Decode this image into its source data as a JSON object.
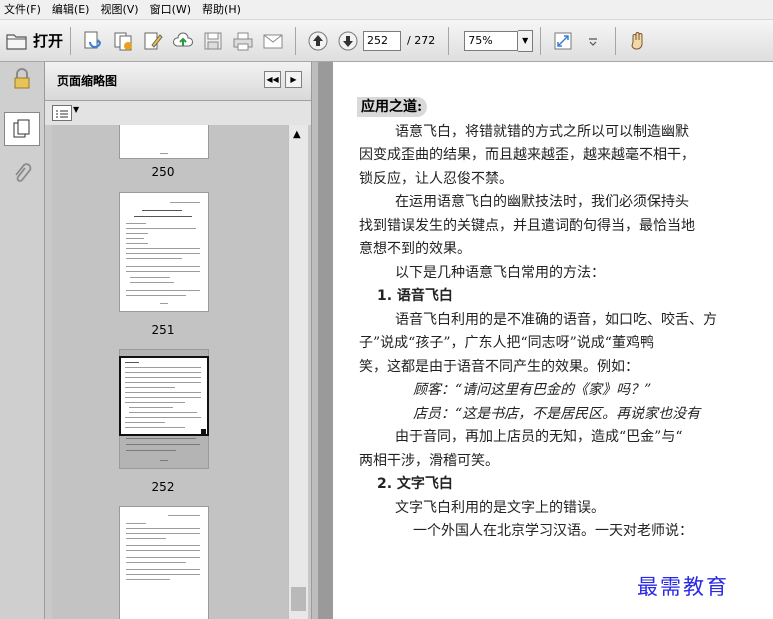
{
  "menu": [
    {
      "label": "文件(F)"
    },
    {
      "label": "编辑(E)"
    },
    {
      "label": "视图(V)"
    },
    {
      "label": "窗口(W)"
    },
    {
      "label": "帮助(H)"
    }
  ],
  "toolbar": {
    "open_label": "打开",
    "current_page": "252",
    "total_pages": "/ 272",
    "zoom": "75%"
  },
  "thumbnails_panel": {
    "title": "页面缩略图",
    "pages": [
      {
        "label": "250"
      },
      {
        "label": "251"
      },
      {
        "label": "252",
        "selected": true
      }
    ]
  },
  "document": {
    "heading": "应用之道:",
    "lines": [
      "语意飞白，将错就错的方式之所以可以制造幽默",
      "因变成歪曲的结果，而且越来越歪，越来越毫不相干，",
      "锁反应，让人忍俊不禁。",
      "在运用语意飞白的幽默技法时，我们必须保持头",
      "找到错误发生的关键点，并且遣词酌句得当，最恰当地",
      "意想不到的效果。",
      "以下是几种语意飞白常用的方法：",
      "1. 语音飞白",
      "语音飞白利用的是不准确的语音，如口吃、咬舌、方",
      "子”说成“孩子”，广东人把“同志呀”说成“董鸡鸭",
      "笑，这都是由于语音不同产生的效果。例如：",
      "顾客：“请问这里有巴金的《家》吗？”",
      "店员：“这是书店，不是居民区。再说家也没有",
      "由于音同，再加上店员的无知，造成“巴金”与“",
      "两相干涉，滑稽可笑。",
      "2. 文字飞白",
      "文字飞白利用的是文字上的错误。",
      "一个外国人在北京学习汉语。一天对老师说："
    ],
    "watermark": "最需教育"
  }
}
